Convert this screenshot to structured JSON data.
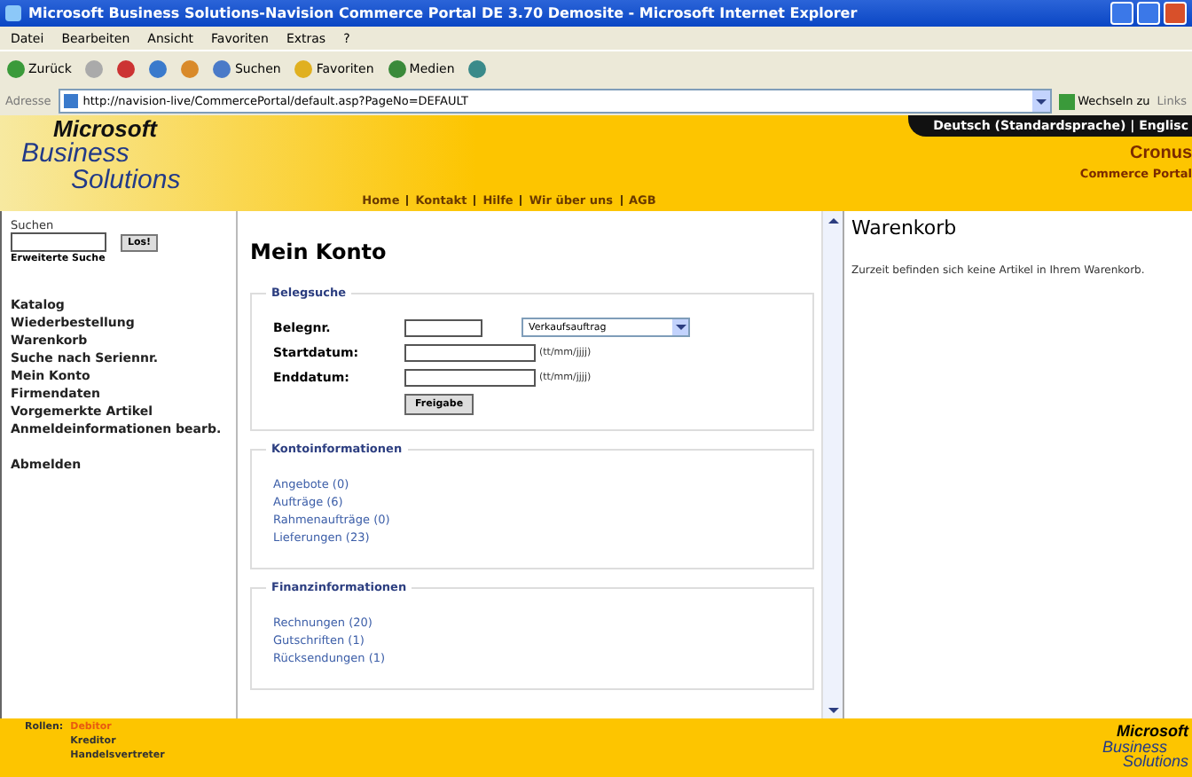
{
  "window": {
    "title": "Microsoft Business Solutions-Navision Commerce Portal DE 3.70 Demosite - Microsoft Internet Explorer"
  },
  "menu": [
    "Datei",
    "Bearbeiten",
    "Ansicht",
    "Favoriten",
    "Extras",
    "?"
  ],
  "toolbar": [
    {
      "kind": "back",
      "label": "Zurück"
    },
    {
      "kind": "forward"
    },
    {
      "kind": "stop"
    },
    {
      "kind": "refresh"
    },
    {
      "kind": "home"
    },
    {
      "kind": "search",
      "label": "Suchen"
    },
    {
      "kind": "favorites",
      "label": "Favoriten"
    },
    {
      "kind": "media",
      "label": "Medien"
    },
    {
      "kind": "history"
    }
  ],
  "address": {
    "label": "Adresse",
    "url": "http://navision-live/CommercePortal/default.asp?PageNo=DEFAULT",
    "go": "Wechseln zu",
    "links": "Links"
  },
  "header": {
    "logo": [
      "Microsoft",
      "Business",
      "Solutions"
    ],
    "languages": "Deutsch (Standardsprache) | Englisc",
    "company": "Cronus",
    "portal": "Commerce Portal",
    "nav": [
      "Home",
      "Kontakt",
      "Hilfe",
      "Wir über uns",
      "AGB"
    ]
  },
  "sidebar": {
    "search_label": "Suchen",
    "search_button": "Los!",
    "advanced": "Erweiterte Suche",
    "items": [
      {
        "label": "Katalog"
      },
      {
        "label": "Wiederbestellung"
      },
      {
        "label": "Warenkorb"
      },
      {
        "label": "Suche nach Seriennr."
      },
      {
        "label": "Mein Konto"
      },
      {
        "label": "Firmendaten"
      },
      {
        "label": "Vorgemerkte Artikel"
      },
      {
        "label": "Anmeldeinformationen bearb."
      }
    ],
    "logout": "Abmelden"
  },
  "main": {
    "title": "Mein Konto",
    "search": {
      "legend": "Belegsuche",
      "doc_label": "Belegnr.",
      "doc_type": "Verkaufsauftrag",
      "start_label": "Startdatum:",
      "end_label": "Enddatum:",
      "start_hint": "(tt/mm/jjjj)",
      "end_hint": "(tt/mm/jjjj)",
      "button": "Freigabe"
    },
    "sections": [
      {
        "legend": "Kontoinformationen",
        "links": [
          "Angebote (0)",
          "Aufträge (6)",
          "Rahmenaufträge (0)",
          "Lieferungen (23)"
        ]
      },
      {
        "legend": "Finanzinformationen",
        "links": [
          "Rechnungen (20)",
          "Gutschriften (1)",
          "Rücksendungen (1)"
        ]
      }
    ]
  },
  "cart": {
    "title": "Warenkorb",
    "text": "Zurzeit befinden sich keine Artikel in Ihrem Warenkorb."
  },
  "footer": {
    "roles_label": "Rollen:",
    "roles": [
      {
        "label": "Debitor",
        "selected": true
      },
      {
        "label": "Kreditor",
        "selected": false
      },
      {
        "label": "Handelsvertreter",
        "selected": false
      }
    ],
    "logo": [
      "Microsoft",
      "Business",
      "Solutions"
    ]
  }
}
